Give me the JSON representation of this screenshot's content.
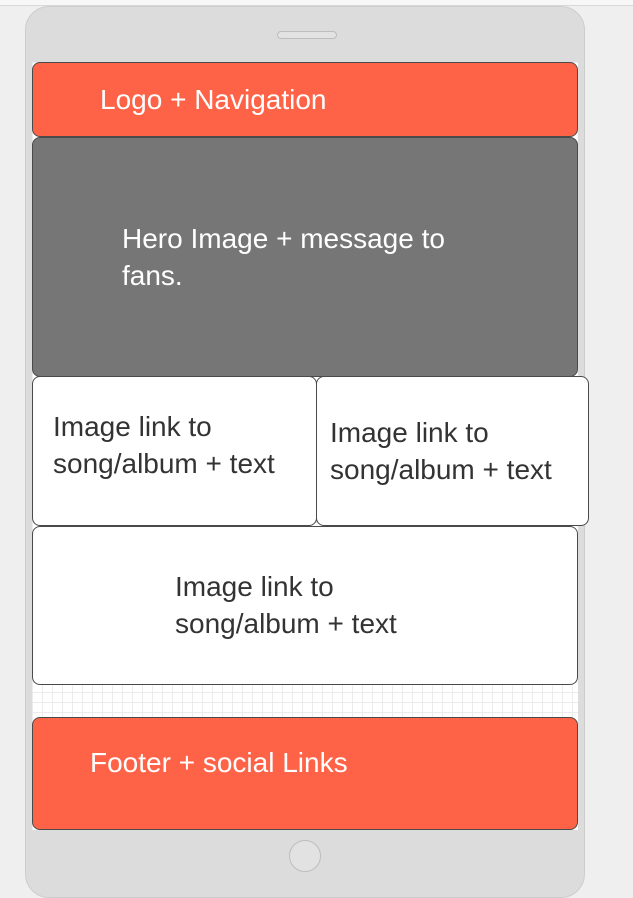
{
  "header": {
    "label": "Logo + Navigation"
  },
  "hero": {
    "label": "Hero Image + message to\nfans."
  },
  "cards": [
    {
      "label": "Image link to\nsong/album + text"
    },
    {
      "label": "Image link to\nsong/album + text"
    },
    {
      "label": "Image link to\nsong/album + text"
    }
  ],
  "footer": {
    "label": "Footer + social Links"
  },
  "colors": {
    "accent": "#ff6347",
    "hero": "#767676",
    "card": "#ffffff",
    "device": "#dcdcdc"
  }
}
